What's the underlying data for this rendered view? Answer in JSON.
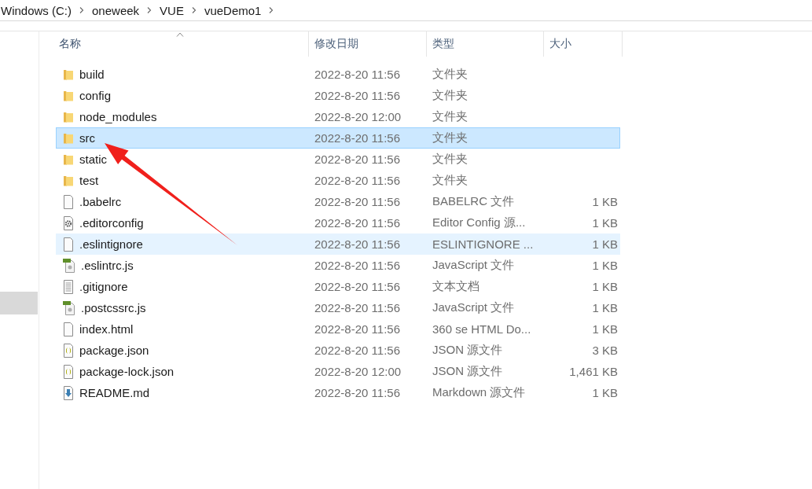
{
  "breadcrumb": [
    "Windows (C:)",
    "oneweek",
    "VUE",
    "vueDemo1"
  ],
  "columns": [
    {
      "label": "名称",
      "sorted": true
    },
    {
      "label": "修改日期",
      "sorted": false
    },
    {
      "label": "类型",
      "sorted": false
    },
    {
      "label": "大小",
      "sorted": false
    }
  ],
  "files": [
    {
      "name": "build",
      "modified": "2022-8-20 11:56",
      "type": "文件夹",
      "kind": "folder",
      "selected": false,
      "hovered": false
    },
    {
      "name": "config",
      "modified": "2022-8-20 11:56",
      "type": "文件夹",
      "kind": "folder",
      "selected": false,
      "hovered": false
    },
    {
      "name": "node_modules",
      "modified": "2022-8-20 12:00",
      "type": "文件夹",
      "kind": "folder",
      "selected": false,
      "hovered": false
    },
    {
      "name": "src",
      "modified": "2022-8-20 11:56",
      "type": "文件夹",
      "kind": "folder",
      "selected": true,
      "hovered": false
    },
    {
      "name": "static",
      "modified": "2022-8-20 11:56",
      "type": "文件夹",
      "kind": "folder",
      "selected": false,
      "hovered": false
    },
    {
      "name": "test",
      "modified": "2022-8-20 11:56",
      "type": "文件夹",
      "kind": "folder",
      "selected": false,
      "hovered": false
    },
    {
      "name": ".babelrc",
      "modified": "2022-8-20 11:56",
      "type": "BABELRC 文件",
      "size": "1 KB",
      "kind": "file",
      "selected": false,
      "hovered": false
    },
    {
      "name": ".editorconfig",
      "modified": "2022-8-20 11:56",
      "type": "Editor Config 源...",
      "size": "1 KB",
      "kind": "settings",
      "selected": false,
      "hovered": false
    },
    {
      "name": ".eslintignore",
      "modified": "2022-8-20 11:56",
      "type": "ESLINTIGNORE ...",
      "size": "1 KB",
      "kind": "file",
      "selected": false,
      "hovered": true
    },
    {
      "name": ".eslintrc.js",
      "modified": "2022-8-20 11:56",
      "type": "JavaScript 文件",
      "size": "1 KB",
      "kind": "js",
      "selected": false,
      "hovered": false
    },
    {
      "name": ".gitignore",
      "modified": "2022-8-20 11:56",
      "type": "文本文档",
      "size": "1 KB",
      "kind": "text",
      "selected": false,
      "hovered": false
    },
    {
      "name": ".postcssrc.js",
      "modified": "2022-8-20 11:56",
      "type": "JavaScript 文件",
      "size": "1 KB",
      "kind": "js",
      "selected": false,
      "hovered": false
    },
    {
      "name": "index.html",
      "modified": "2022-8-20 11:56",
      "type": "360 se HTML Do...",
      "size": "1 KB",
      "kind": "file",
      "selected": false,
      "hovered": false
    },
    {
      "name": "package.json",
      "modified": "2022-8-20 11:56",
      "type": "JSON 源文件",
      "size": "3 KB",
      "kind": "json",
      "selected": false,
      "hovered": false
    },
    {
      "name": "package-lock.json",
      "modified": "2022-8-20 12:00",
      "type": "JSON 源文件",
      "size": "1,461 KB",
      "kind": "json",
      "selected": false,
      "hovered": false
    },
    {
      "name": "README.md",
      "modified": "2022-8-20 11:56",
      "type": "Markdown 源文件",
      "size": "1 KB",
      "kind": "markdown",
      "selected": false,
      "hovered": false
    }
  ],
  "annotations": [
    {
      "kind": "arrow"
    }
  ]
}
